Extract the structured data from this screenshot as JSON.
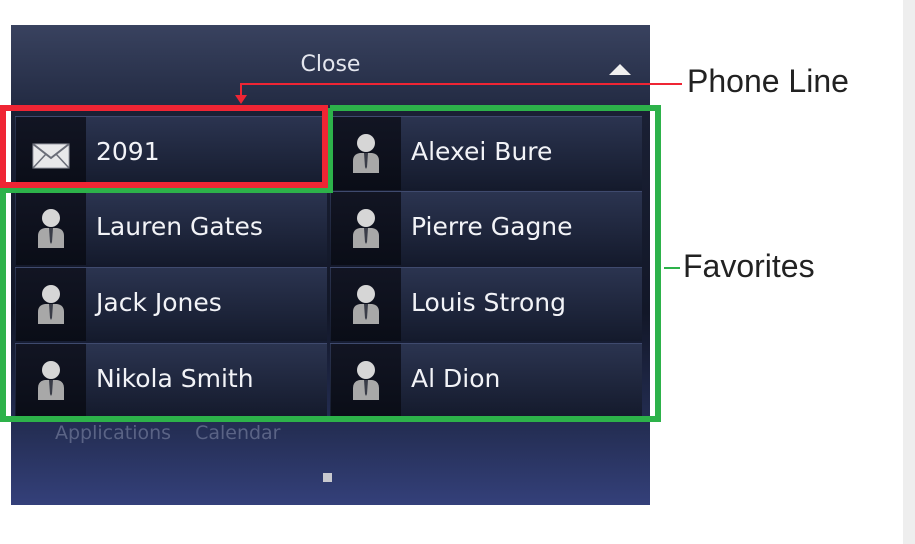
{
  "header": {
    "close_label": "Close"
  },
  "phone_line": {
    "number": "2091",
    "icon": "envelope-icon"
  },
  "favorites": [
    {
      "name": "Alexei Bure"
    },
    {
      "name": "Lauren Gates"
    },
    {
      "name": "Pierre Gagne"
    },
    {
      "name": "Jack Jones"
    },
    {
      "name": "Louis Strong"
    },
    {
      "name": "Nikola Smith"
    },
    {
      "name": "Al Dion"
    }
  ],
  "bottom_nav": {
    "applications": "Applications",
    "calendar": "Calendar"
  },
  "callouts": {
    "phone_line": "Phone Line",
    "favorites": "Favorites"
  },
  "colors": {
    "phone_line_highlight": "#ef2534",
    "favorites_highlight": "#2db24a"
  }
}
